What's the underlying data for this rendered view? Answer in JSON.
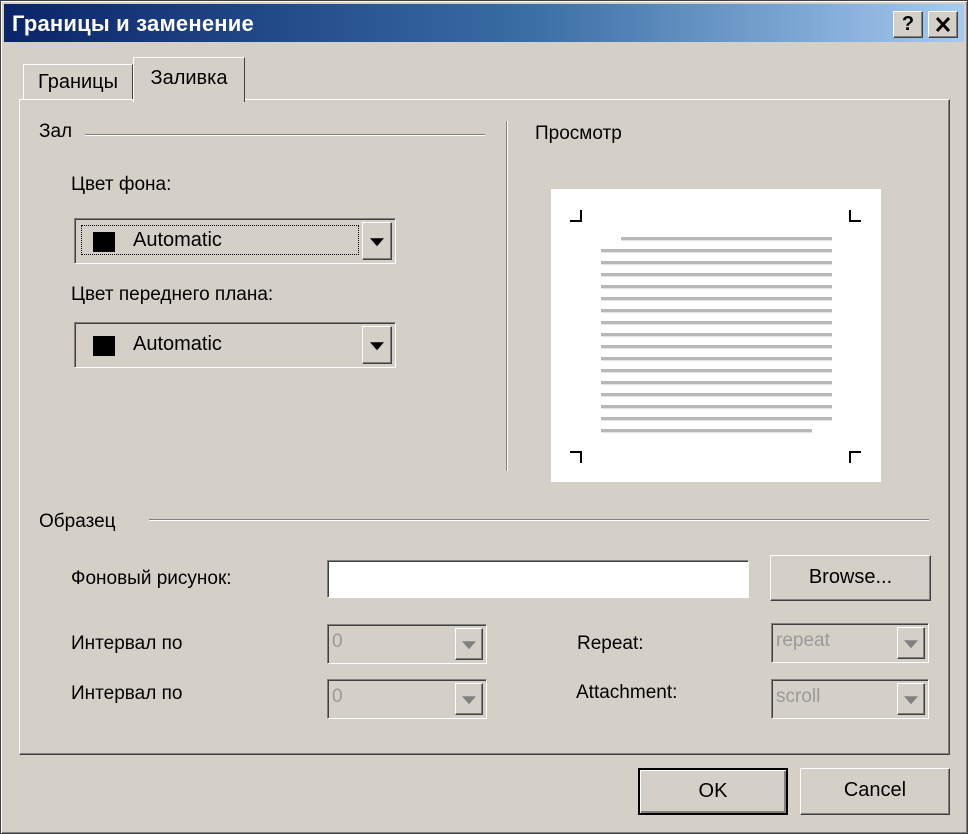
{
  "window": {
    "title": "Границы и заменение",
    "help_label": "?",
    "close_label": "✕"
  },
  "tabs": [
    {
      "label": "Границы",
      "active": false
    },
    {
      "label": "Заливка",
      "active": true
    }
  ],
  "fill_group": {
    "legend": "Зал",
    "background_color_label": "Цвет фона:",
    "background_color_value": "Automatic",
    "foreground_color_label": "Цвет переднего плана:",
    "foreground_color_value": "Automatic"
  },
  "preview_group": {
    "legend": "Просмотр"
  },
  "sample_group": {
    "legend": "Образец",
    "background_image_label": "Фоновый рисунок:",
    "background_image_value": "",
    "browse_label": "Browse...",
    "interval1_label": "Интервал по",
    "interval1_value": "0",
    "interval2_label": "Интервал по",
    "interval2_value": "0",
    "repeat_label": "Repeat:",
    "repeat_value": "repeat",
    "attachment_label": "Attachment:",
    "attachment_value": "scroll"
  },
  "footer": {
    "ok_label": "OK",
    "cancel_label": "Cancel"
  },
  "colors": {
    "dialog_bg": "#d4d0c8",
    "title_gradient_start": "#0a246a",
    "title_gradient_end": "#a6caf0",
    "swatch": "#000000"
  }
}
